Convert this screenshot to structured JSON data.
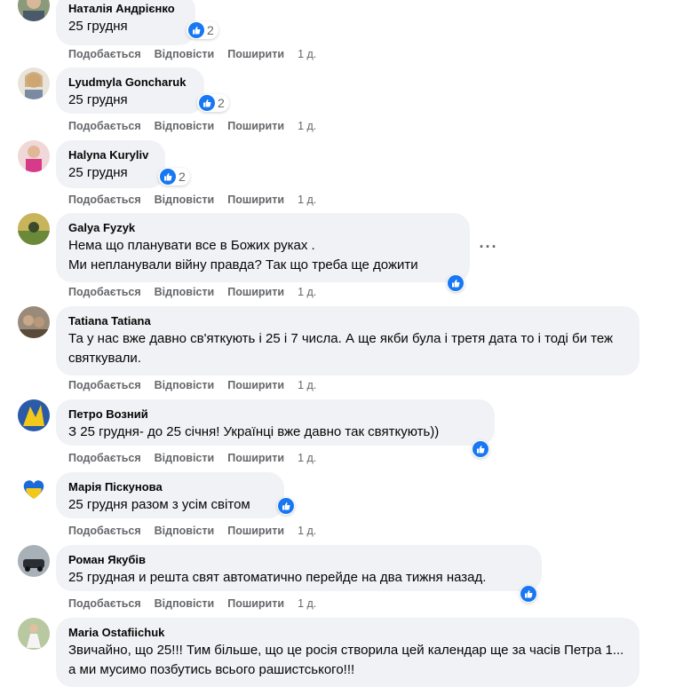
{
  "actions": {
    "like_label": "Подобається",
    "reply_label": "Відповісти",
    "share_label": "Поширити"
  },
  "icons": {
    "like": "thumbs-up-icon",
    "more": "more-horizontal-icon"
  },
  "colors": {
    "like_blue": "#1877f2",
    "bubble_bg": "#f0f2f5",
    "meta_gray": "#65676b"
  },
  "comments": [
    {
      "author": "Наталія Андрієнко",
      "text": "25 грудня",
      "likes": "2",
      "time": "1 д."
    },
    {
      "author": "Lyudmyla Goncharuk",
      "text": "25 грудня",
      "likes": "2",
      "time": "1 д."
    },
    {
      "author": "Halyna Kuryliv",
      "text": "25 грудня",
      "likes": "2",
      "time": "1 д."
    },
    {
      "author": "Galya Fyzyk",
      "text": "Нема що планувати все в Божих руках .\nМи непланували війну правда? Так що треба ще дожити",
      "likes": "",
      "time": "1 д."
    },
    {
      "author": "Tatiana Tatiana",
      "text": "Та у нас вже давно св'яткують і 25 і 7 числа. А ще якби була і третя дата то і тоді би теж святкували.",
      "likes": "",
      "time": "1 д."
    },
    {
      "author": "Петро Возний",
      "text": "З 25 грудня- до 25 січня! Українці вже давно так святкують))",
      "likes": "",
      "time": "1 д."
    },
    {
      "author": "Марія Піскунова",
      "text": "25 грудня разом з усім світом",
      "likes": "",
      "time": "1 д."
    },
    {
      "author": "Роман Якубів",
      "text": "25 грудная и решта свят автоматично перейде на два тижня назад.",
      "likes": "",
      "time": "1 д."
    },
    {
      "author": "Maria Ostafiichuk",
      "text": "Звичайно, що 25!!! Тим більше, що це росія створила цей календар ще за часів Петра 1... а ми мусимо позбутись всього рашистського!!!",
      "likes": "",
      "time": ""
    }
  ]
}
